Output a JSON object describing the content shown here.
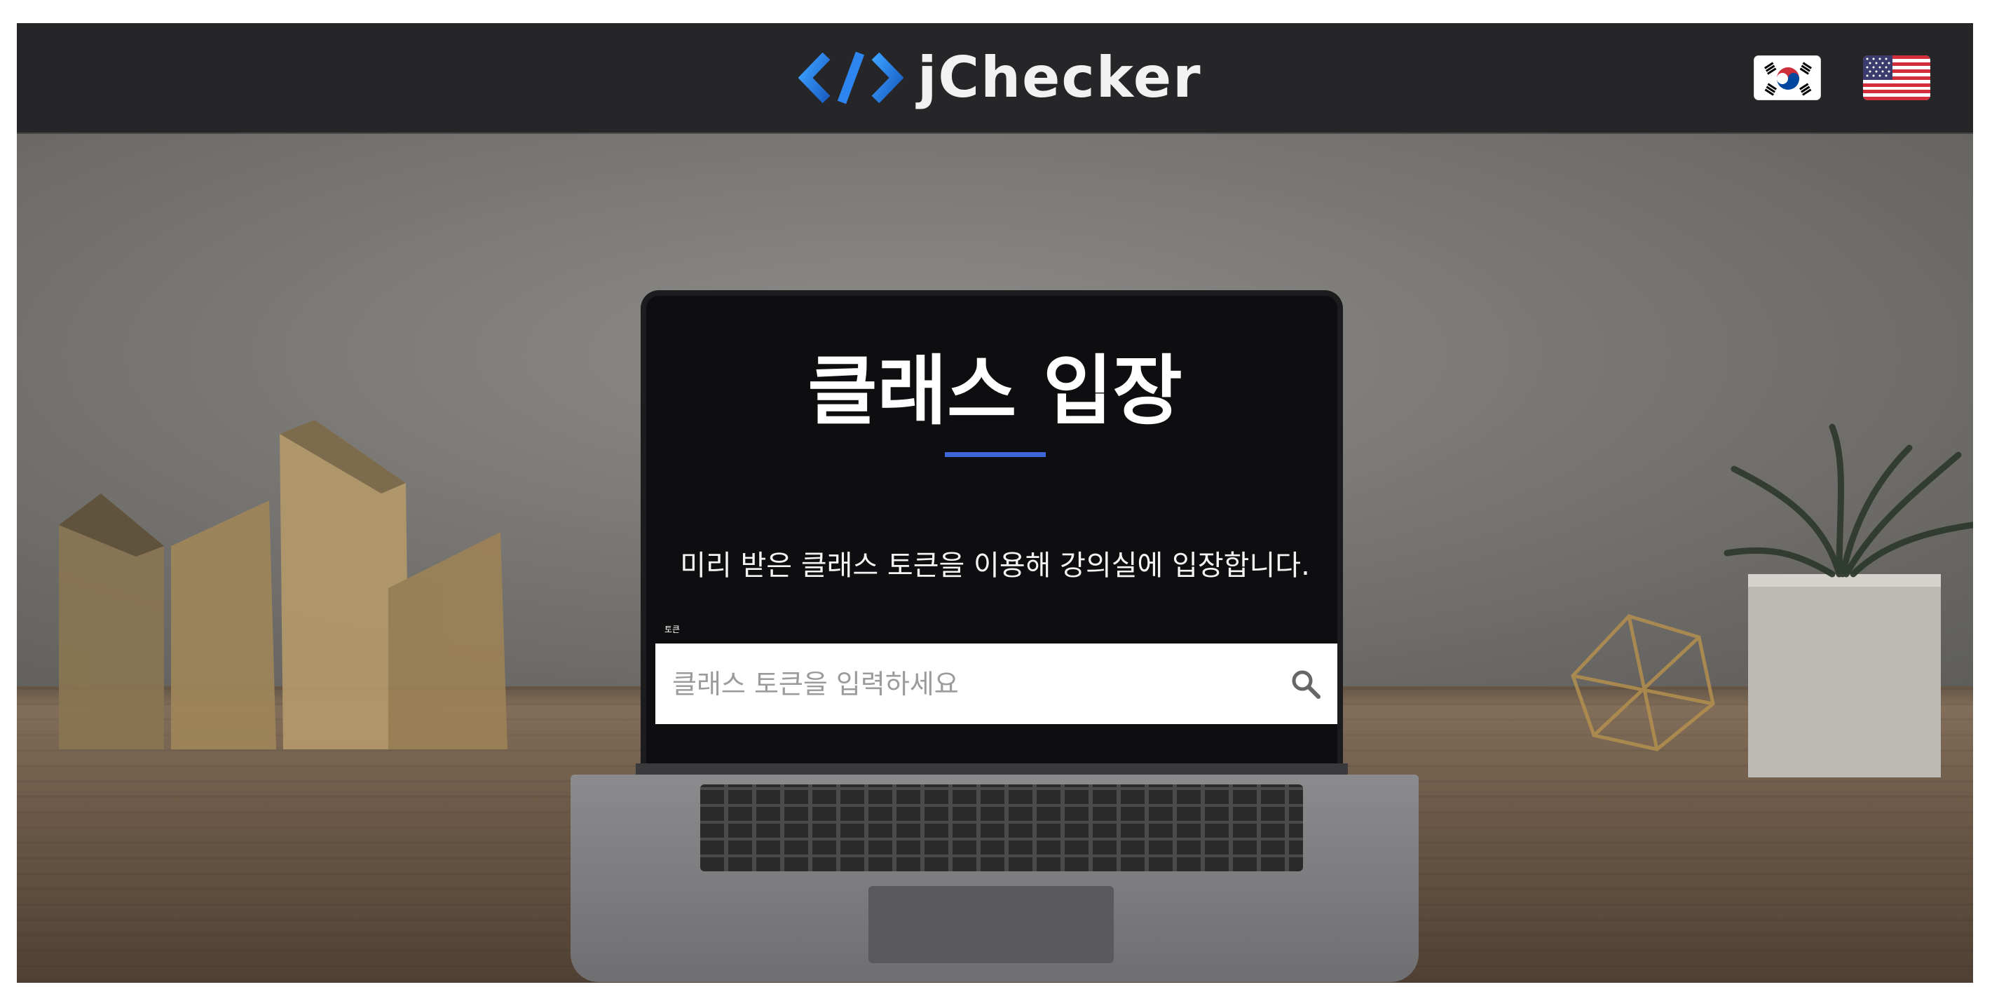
{
  "header": {
    "logo_text": "jChecker",
    "logo_icon": "code-brackets-icon",
    "languages": [
      {
        "code": "ko",
        "icon": "korea-flag-icon"
      },
      {
        "code": "en",
        "icon": "usa-flag-icon"
      }
    ]
  },
  "main": {
    "title": "클래스 입장",
    "accent_color": "#3f66d6",
    "description": "미리 받은 클래스 토큰을 이용해 강의실에 입장합니다.",
    "input_label": "토큰",
    "search": {
      "placeholder": "클래스 토큰을 입력하세요",
      "value": "",
      "icon": "search-icon"
    }
  },
  "colors": {
    "header_bg": "#262628",
    "accent": "#3f66d6"
  }
}
